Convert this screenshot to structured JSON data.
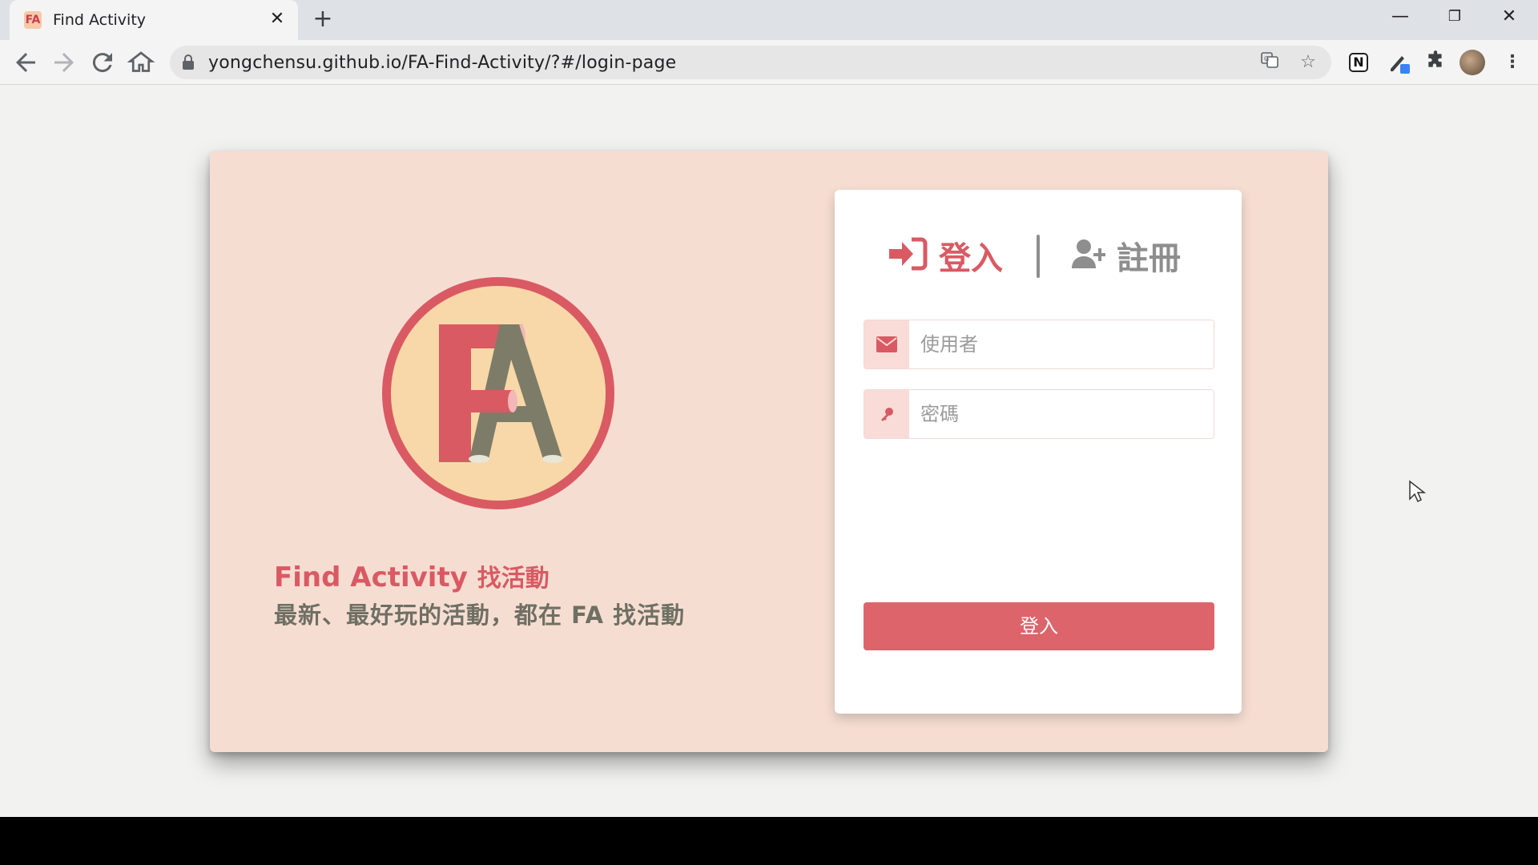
{
  "browser": {
    "tab_title": "Find Activity",
    "tab_favicon": "FA",
    "tab_close": "✕",
    "new_tab": "+",
    "url": "yongchensu.github.io/FA-Find-Activity/?#/login-page",
    "window_minimize": "—",
    "window_restore": "❐",
    "window_close": "✕",
    "extension_notion": "N"
  },
  "brand": {
    "title": "Find Activity",
    "title_cn": "找活動",
    "slogan": "最新、最好玩的活動，都在 FA 找活動"
  },
  "auth": {
    "tabs": {
      "login": "登入",
      "signup": "註冊"
    },
    "username_placeholder": "使用者",
    "password_placeholder": "密碼",
    "submit_label": "登入"
  },
  "colors": {
    "accent": "#dc646a",
    "card_bg": "#f6ddd2",
    "logo_ring": "#d95a63",
    "logo_fill": "#f8d8a8",
    "logo_a": "#7d7c68"
  }
}
